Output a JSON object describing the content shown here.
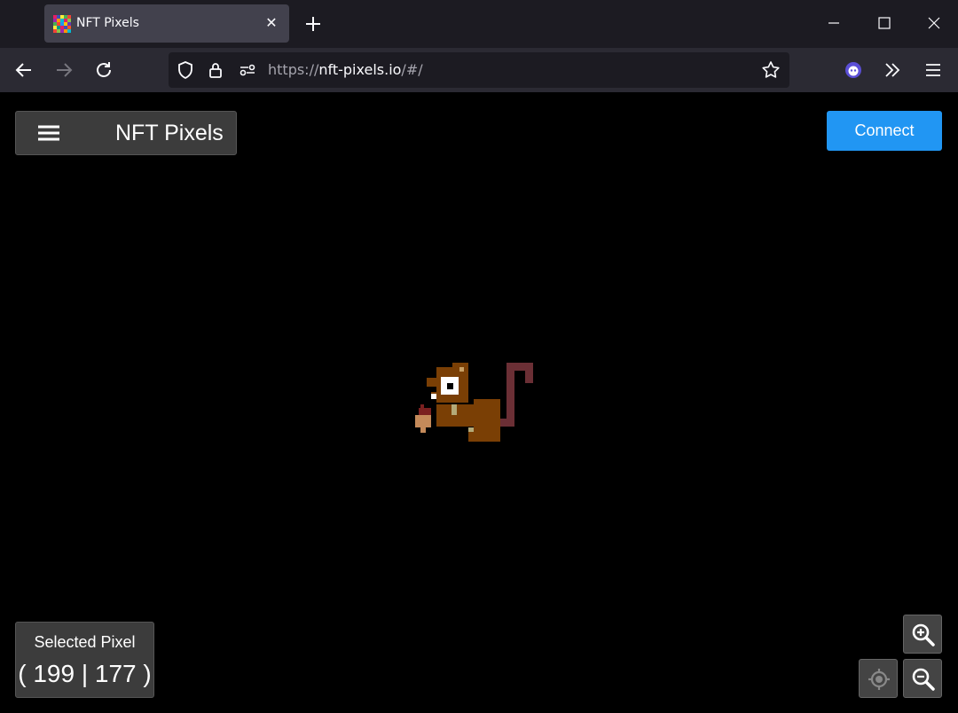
{
  "browser": {
    "tab_title": "NFT Pixels",
    "url_prefix": "https://",
    "url_host": "nft-pixels.io",
    "url_path": "/#/"
  },
  "app": {
    "title": "NFT Pixels",
    "connect_label": "Connect",
    "selected_pixel_label": "Selected Pixel",
    "selected_pixel_value": "( 199 | 177 )",
    "accent_color": "#2196f3"
  },
  "icons": {
    "menu": "hamburger-icon",
    "zoom_in": "zoom-in-icon",
    "zoom_out": "zoom-out-icon",
    "locate": "crosshair-icon"
  }
}
